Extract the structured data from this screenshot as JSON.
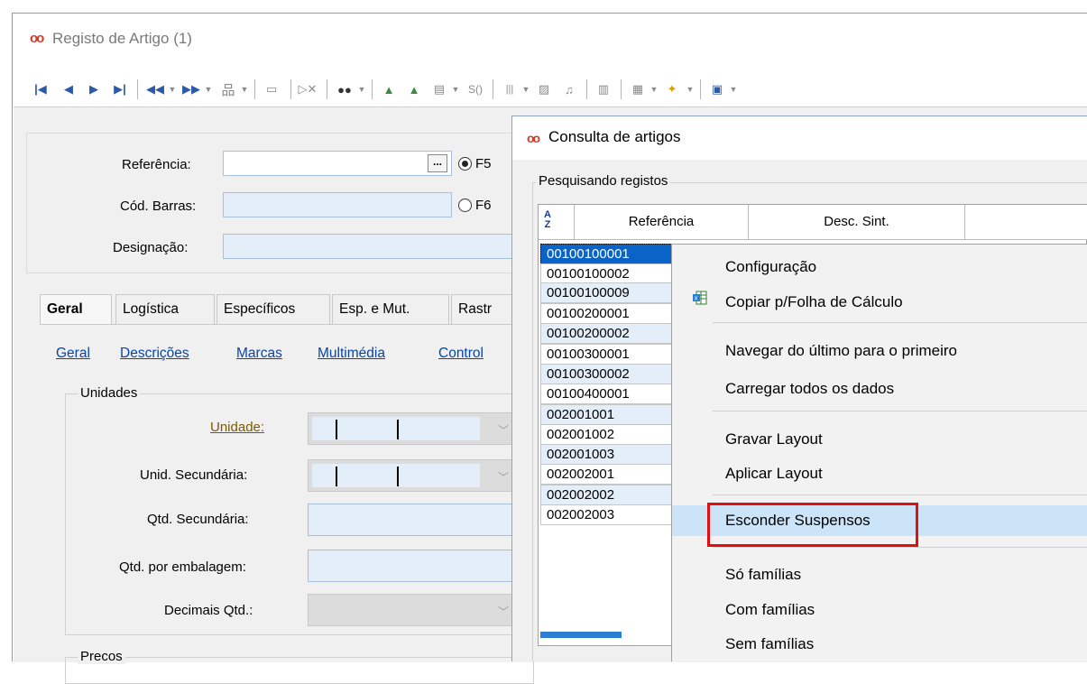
{
  "main_window": {
    "title": "Registo de Artigo (1)",
    "form": {
      "referencia_label": "Referência:",
      "codbarras_label": "Cód. Barras:",
      "designacao_label": "Designação:",
      "ellipsis": "...",
      "f5_label": "F5",
      "f6_label": "F6"
    },
    "tabs": [
      "Geral",
      "Logística",
      "Específicos",
      "Esp. e Mut.",
      "Rastr"
    ],
    "subtabs": [
      "Geral",
      "Descrições",
      "Marcas",
      "Multimédia",
      "Control"
    ],
    "unidades": {
      "group_title": "Unidades",
      "unidade_label": "Unidade:",
      "unid_secundaria_label": "Unid. Secundária:",
      "qtd_secundaria_label": "Qtd. Secundária:",
      "qtd_embalagem_label": "Qtd. por embalagem:",
      "decimais_label": "Decimais Qtd.:"
    },
    "precos_group_title": "Precos"
  },
  "toolbar": {
    "first": "⏮",
    "prev": "◀",
    "next": "▶",
    "last": "⏭",
    "rewind": "◀◀",
    "forward": "▶▶"
  },
  "dialog": {
    "title": "Consulta de artigos",
    "group_title": "Pesquisando registos",
    "columns": [
      "Referência",
      "Desc. Sint."
    ],
    "sort_icon": "A Z",
    "rows": [
      "00100100001",
      "00100100002",
      "00100100009",
      "00100200001",
      "00100200002",
      "00100300001",
      "00100300002",
      "00100400001",
      "002001001",
      "002001002",
      "002001003",
      "002002001",
      "002002002",
      "002002003"
    ]
  },
  "context_menu": {
    "items": [
      "Configuração",
      "Copiar p/Folha de Cálculo",
      "Navegar do último para o primeiro",
      "Carregar todos os dados",
      "Gravar Layout",
      "Aplicar Layout",
      "Esconder Suspensos",
      "Só famílias",
      "Com famílias",
      "Sem famílias"
    ],
    "highlighted": "Esconder Suspensos"
  },
  "colors": {
    "accent": "#0a64c8",
    "highlight": "#cce4f7",
    "annotation": "#e01010",
    "logo": "#d23b2a"
  }
}
